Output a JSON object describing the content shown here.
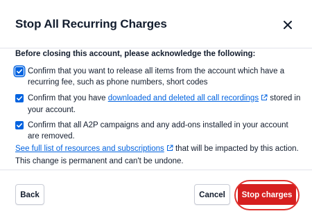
{
  "dialog": {
    "title": "Stop All Recurring Charges",
    "close_icon": "close-icon"
  },
  "body": {
    "acknowledge_heading": "Before closing this account, please acknowledge the following:",
    "items": [
      {
        "checked": true,
        "text": "Confirm that you want to release all items from the account which have a recurring fee, such as phone numbers, short codes"
      },
      {
        "checked": true,
        "text_before": "Confirm that you have ",
        "link_text": "downloaded and deleted all call recordings",
        "link_icon": "external-link-icon",
        "text_after": " stored in your account."
      },
      {
        "checked": true,
        "text": "Confirm that all A2P campaigns and any add-ons installed in your account are removed."
      }
    ],
    "resources_link": "See full list of resources and subscriptions",
    "resources_link_icon": "external-link-icon",
    "resources_after": " that will be impacted by this action.",
    "permanent_note": "This change is permanent and can't be undone."
  },
  "footer": {
    "back_label": "Back",
    "cancel_label": "Cancel",
    "stop_label": "Stop charges"
  },
  "colors": {
    "primary_blue": "#0263e0",
    "danger_red": "#d61f1f",
    "annotation_red": "#e0302c",
    "text": "#121c2d"
  }
}
